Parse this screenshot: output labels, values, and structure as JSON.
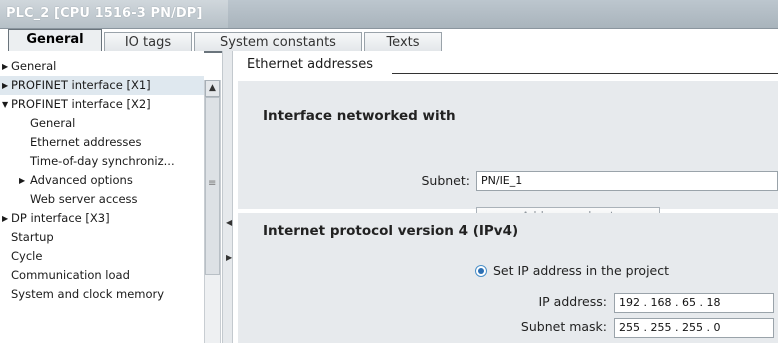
{
  "window": {
    "title": "PLC_2 [CPU 1516-3 PN/DP]"
  },
  "tabs": [
    {
      "label": "General",
      "active": true
    },
    {
      "label": "IO tags",
      "active": false
    },
    {
      "label": "System constants",
      "active": false
    },
    {
      "label": "Texts",
      "active": false
    }
  ],
  "nav": {
    "items": [
      {
        "label": "General"
      },
      {
        "label": "PROFINET interface [X1]"
      },
      {
        "label": "PROFINET interface [X2]"
      },
      {
        "label": "General"
      },
      {
        "label": "Ethernet addresses"
      },
      {
        "label": "Time-of-day synchroniz..."
      },
      {
        "label": "Advanced options"
      },
      {
        "label": "Web server access"
      },
      {
        "label": "DP interface [X3]"
      },
      {
        "label": "Startup"
      },
      {
        "label": "Cycle"
      },
      {
        "label": "Communication load"
      },
      {
        "label": "System and clock memory"
      }
    ]
  },
  "content": {
    "section_title": "Ethernet addresses",
    "interface": {
      "title": "Interface networked with",
      "subnet_label": "Subnet:",
      "subnet_value": "PN/IE_1",
      "add_subnet_button": "Add new subnet"
    },
    "ipv4": {
      "title": "Internet protocol version 4 (IPv4)",
      "radio_label": "Set IP address in the project",
      "ip_label": "IP address:",
      "ip_value": "192 . 168 . 65  . 18",
      "mask_label": "Subnet mask:",
      "mask_value": "255 . 255 . 255 . 0"
    }
  }
}
